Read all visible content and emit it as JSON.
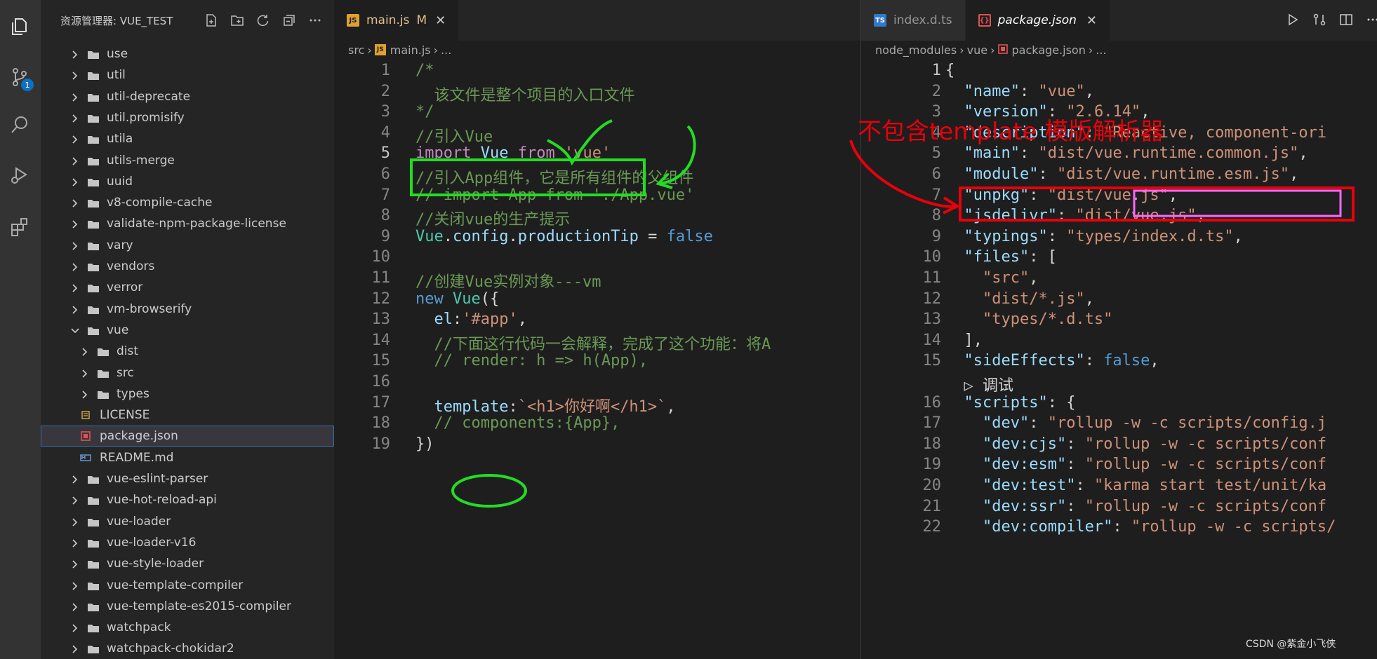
{
  "activity_bar": {
    "items": [
      "explorer-icon",
      "source-control-icon",
      "search-icon",
      "run-debug-icon",
      "extensions-icon"
    ],
    "scm_badge": "1"
  },
  "sidebar": {
    "title": "资源管理器: VUE_TEST",
    "items": [
      {
        "label": "use",
        "type": "folder",
        "open": false,
        "level": 1
      },
      {
        "label": "util",
        "type": "folder",
        "open": false,
        "level": 1
      },
      {
        "label": "util-deprecate",
        "type": "folder",
        "open": false,
        "level": 1
      },
      {
        "label": "util.promisify",
        "type": "folder",
        "open": false,
        "level": 1
      },
      {
        "label": "utila",
        "type": "folder",
        "open": false,
        "level": 1
      },
      {
        "label": "utils-merge",
        "type": "folder",
        "open": false,
        "level": 1
      },
      {
        "label": "uuid",
        "type": "folder",
        "open": false,
        "level": 1
      },
      {
        "label": "v8-compile-cache",
        "type": "folder",
        "open": false,
        "level": 1
      },
      {
        "label": "validate-npm-package-license",
        "type": "folder",
        "open": false,
        "level": 1
      },
      {
        "label": "vary",
        "type": "folder",
        "open": false,
        "level": 1
      },
      {
        "label": "vendors",
        "type": "folder",
        "open": false,
        "level": 1
      },
      {
        "label": "verror",
        "type": "folder",
        "open": false,
        "level": 1
      },
      {
        "label": "vm-browserify",
        "type": "folder",
        "open": false,
        "level": 1
      },
      {
        "label": "vue",
        "type": "folder",
        "open": true,
        "level": 1
      },
      {
        "label": "dist",
        "type": "folder",
        "open": false,
        "level": 2
      },
      {
        "label": "src",
        "type": "folder",
        "open": false,
        "level": 2
      },
      {
        "label": "types",
        "type": "folder",
        "open": false,
        "level": 2
      },
      {
        "label": "LICENSE",
        "type": "license",
        "level": 2
      },
      {
        "label": "package.json",
        "type": "json",
        "level": 2,
        "selected": true
      },
      {
        "label": "README.md",
        "type": "md",
        "level": 2
      },
      {
        "label": "vue-eslint-parser",
        "type": "folder",
        "open": false,
        "level": 1
      },
      {
        "label": "vue-hot-reload-api",
        "type": "folder",
        "open": false,
        "level": 1
      },
      {
        "label": "vue-loader",
        "type": "folder",
        "open": false,
        "level": 1
      },
      {
        "label": "vue-loader-v16",
        "type": "folder",
        "open": false,
        "level": 1
      },
      {
        "label": "vue-style-loader",
        "type": "folder",
        "open": false,
        "level": 1
      },
      {
        "label": "vue-template-compiler",
        "type": "folder",
        "open": false,
        "level": 1
      },
      {
        "label": "vue-template-es2015-compiler",
        "type": "folder",
        "open": false,
        "level": 1
      },
      {
        "label": "watchpack",
        "type": "folder",
        "open": false,
        "level": 1
      },
      {
        "label": "watchpack-chokidar2",
        "type": "folder",
        "open": false,
        "level": 1
      }
    ]
  },
  "left_editor": {
    "tab": {
      "label": "main.js",
      "status": "M",
      "icon": "JS"
    },
    "breadcrumb": [
      "src",
      "main.js",
      "..."
    ],
    "lines": [
      {
        "n": "1",
        "segs": [
          [
            "cm",
            "/*"
          ]
        ]
      },
      {
        "n": "2",
        "segs": [
          [
            "cm",
            "  该文件是整个项目的入口文件"
          ]
        ]
      },
      {
        "n": "3",
        "segs": [
          [
            "cm",
            "*/"
          ]
        ]
      },
      {
        "n": "4",
        "segs": [
          [
            "cm",
            "//引入Vue"
          ]
        ]
      },
      {
        "n": "5",
        "segs": [
          [
            "kw",
            "import"
          ],
          [
            "punc",
            " "
          ],
          [
            "var",
            "Vue"
          ],
          [
            "punc",
            " "
          ],
          [
            "kw",
            "from"
          ],
          [
            "punc",
            " "
          ],
          [
            "str",
            "'vue'"
          ]
        ]
      },
      {
        "n": "6",
        "segs": [
          [
            "cm",
            "//引入App组件，它是所有组件的父组件"
          ]
        ]
      },
      {
        "n": "7",
        "segs": [
          [
            "cm",
            "// import App from './App.vue'"
          ]
        ]
      },
      {
        "n": "8",
        "segs": [
          [
            "cm",
            "//关闭vue的生产提示"
          ]
        ]
      },
      {
        "n": "9",
        "segs": [
          [
            "cls",
            "Vue"
          ],
          [
            "punc",
            "."
          ],
          [
            "prop",
            "config"
          ],
          [
            "punc",
            "."
          ],
          [
            "prop",
            "productionTip"
          ],
          [
            "punc",
            " = "
          ],
          [
            "kw2",
            "false"
          ]
        ]
      },
      {
        "n": "10",
        "segs": []
      },
      {
        "n": "11",
        "segs": [
          [
            "cm",
            "//创建Vue实例对象---vm"
          ]
        ]
      },
      {
        "n": "12",
        "segs": [
          [
            "kw2",
            "new"
          ],
          [
            "punc",
            " "
          ],
          [
            "cls",
            "Vue"
          ],
          [
            "punc",
            "({"
          ]
        ]
      },
      {
        "n": "13",
        "segs": [
          [
            "punc",
            "  "
          ],
          [
            "prop",
            "el"
          ],
          [
            "punc",
            ":"
          ],
          [
            "str",
            "'#app'"
          ],
          [
            "punc",
            ","
          ]
        ]
      },
      {
        "n": "14",
        "segs": [
          [
            "cm",
            "  //下面这行代码一会解释，完成了这个功能：将A"
          ]
        ]
      },
      {
        "n": "15",
        "segs": [
          [
            "cm",
            "  // render: h => h(App),"
          ]
        ]
      },
      {
        "n": "16",
        "segs": []
      },
      {
        "n": "17",
        "segs": [
          [
            "punc",
            "  "
          ],
          [
            "prop",
            "template"
          ],
          [
            "punc",
            ":"
          ],
          [
            "str",
            "`<h1>你好啊</h1>`"
          ],
          [
            "punc",
            ","
          ]
        ]
      },
      {
        "n": "18",
        "segs": [
          [
            "cm",
            "  // components:{App},"
          ]
        ]
      },
      {
        "n": "19",
        "segs": [
          [
            "punc",
            "})"
          ]
        ]
      }
    ]
  },
  "right_editor": {
    "tabs": [
      {
        "label": "index.d.ts",
        "icon": "TS",
        "active": false
      },
      {
        "label": "package.json",
        "icon": "{}",
        "active": true
      }
    ],
    "breadcrumb": [
      "node_modules",
      "vue",
      "package.json",
      "..."
    ],
    "lines": [
      {
        "n": "1",
        "segs": [
          [
            "punc",
            "{"
          ]
        ]
      },
      {
        "n": "2",
        "segs": [
          [
            "punc",
            "  "
          ],
          [
            "key",
            "\"name\""
          ],
          [
            "punc",
            ": "
          ],
          [
            "strv",
            "\"vue\""
          ],
          [
            "punc",
            ","
          ]
        ]
      },
      {
        "n": "3",
        "segs": [
          [
            "punc",
            "  "
          ],
          [
            "key",
            "\"version\""
          ],
          [
            "punc",
            ": "
          ],
          [
            "strv",
            "\"2.6.14\""
          ],
          [
            "punc",
            ","
          ]
        ]
      },
      {
        "n": "4",
        "segs": [
          [
            "punc",
            "  "
          ],
          [
            "key",
            "\"description\""
          ],
          [
            "punc",
            ": "
          ],
          [
            "strv",
            "\"Reactive, component-ori"
          ]
        ]
      },
      {
        "n": "5",
        "segs": [
          [
            "punc",
            "  "
          ],
          [
            "key",
            "\"main\""
          ],
          [
            "punc",
            ": "
          ],
          [
            "strv",
            "\"dist/vue.runtime.common.js\""
          ],
          [
            "punc",
            ","
          ]
        ]
      },
      {
        "n": "6",
        "segs": [
          [
            "punc",
            "  "
          ],
          [
            "key",
            "\"module\""
          ],
          [
            "punc",
            ": "
          ],
          [
            "strv",
            "\"dist/vue.runtime.esm.js\""
          ],
          [
            "punc",
            ","
          ]
        ]
      },
      {
        "n": "7",
        "segs": [
          [
            "punc",
            "  "
          ],
          [
            "key",
            "\"unpkg\""
          ],
          [
            "punc",
            ": "
          ],
          [
            "strv",
            "\"dist/vue.js\""
          ],
          [
            "punc",
            ","
          ]
        ]
      },
      {
        "n": "8",
        "segs": [
          [
            "punc",
            "  "
          ],
          [
            "key",
            "\"jsdelivr\""
          ],
          [
            "punc",
            ": "
          ],
          [
            "strv",
            "\"dist/vue.js\""
          ],
          [
            "punc",
            ","
          ]
        ]
      },
      {
        "n": "9",
        "segs": [
          [
            "punc",
            "  "
          ],
          [
            "key",
            "\"typings\""
          ],
          [
            "punc",
            ": "
          ],
          [
            "strv",
            "\"types/index.d.ts\""
          ],
          [
            "punc",
            ","
          ]
        ]
      },
      {
        "n": "10",
        "segs": [
          [
            "punc",
            "  "
          ],
          [
            "key",
            "\"files\""
          ],
          [
            "punc",
            ": ["
          ]
        ]
      },
      {
        "n": "11",
        "segs": [
          [
            "punc",
            "    "
          ],
          [
            "strv",
            "\"src\""
          ],
          [
            "punc",
            ","
          ]
        ]
      },
      {
        "n": "12",
        "segs": [
          [
            "punc",
            "    "
          ],
          [
            "strv",
            "\"dist/*.js\""
          ],
          [
            "punc",
            ","
          ]
        ]
      },
      {
        "n": "13",
        "segs": [
          [
            "punc",
            "    "
          ],
          [
            "strv",
            "\"types/*.d.ts\""
          ]
        ]
      },
      {
        "n": "14",
        "segs": [
          [
            "punc",
            "  ],"
          ]
        ]
      },
      {
        "n": "15",
        "segs": [
          [
            "punc",
            "  "
          ],
          [
            "key",
            "\"sideEffects\""
          ],
          [
            "punc",
            ": "
          ],
          [
            "kw2",
            "false"
          ],
          [
            "punc",
            ","
          ]
        ]
      },
      {
        "n": "",
        "segs": [
          [
            "punc",
            "  ▷ 调试"
          ]
        ]
      },
      {
        "n": "16",
        "segs": [
          [
            "punc",
            "  "
          ],
          [
            "key",
            "\"scripts\""
          ],
          [
            "punc",
            ": {"
          ]
        ]
      },
      {
        "n": "17",
        "segs": [
          [
            "punc",
            "    "
          ],
          [
            "key",
            "\"dev\""
          ],
          [
            "punc",
            ": "
          ],
          [
            "strv",
            "\"rollup -w -c scripts/config.j"
          ]
        ]
      },
      {
        "n": "18",
        "segs": [
          [
            "punc",
            "    "
          ],
          [
            "key",
            "\"dev:cjs\""
          ],
          [
            "punc",
            ": "
          ],
          [
            "strv",
            "\"rollup -w -c scripts/conf"
          ]
        ]
      },
      {
        "n": "19",
        "segs": [
          [
            "punc",
            "    "
          ],
          [
            "key",
            "\"dev:esm\""
          ],
          [
            "punc",
            ": "
          ],
          [
            "strv",
            "\"rollup -w -c scripts/conf"
          ]
        ]
      },
      {
        "n": "20",
        "segs": [
          [
            "punc",
            "    "
          ],
          [
            "key",
            "\"dev:test\""
          ],
          [
            "punc",
            ": "
          ],
          [
            "strv",
            "\"karma start test/unit/ka"
          ]
        ]
      },
      {
        "n": "21",
        "segs": [
          [
            "punc",
            "    "
          ],
          [
            "key",
            "\"dev:ssr\""
          ],
          [
            "punc",
            ": "
          ],
          [
            "strv",
            "\"rollup -w -c scripts/conf"
          ]
        ]
      },
      {
        "n": "22",
        "segs": [
          [
            "punc",
            "    "
          ],
          [
            "key",
            "\"dev:compiler\""
          ],
          [
            "punc",
            ": "
          ],
          [
            "strv",
            "\"rollup -w -c scripts/"
          ]
        ]
      }
    ]
  },
  "annotation": {
    "text": "不包含template 模版解析器",
    "color": "#e8000a"
  },
  "watermark": "CSDN @紫金小飞侠",
  "colors": {
    "green": "#22dd22",
    "red": "#e8000a",
    "pink": "#ff66ff"
  }
}
